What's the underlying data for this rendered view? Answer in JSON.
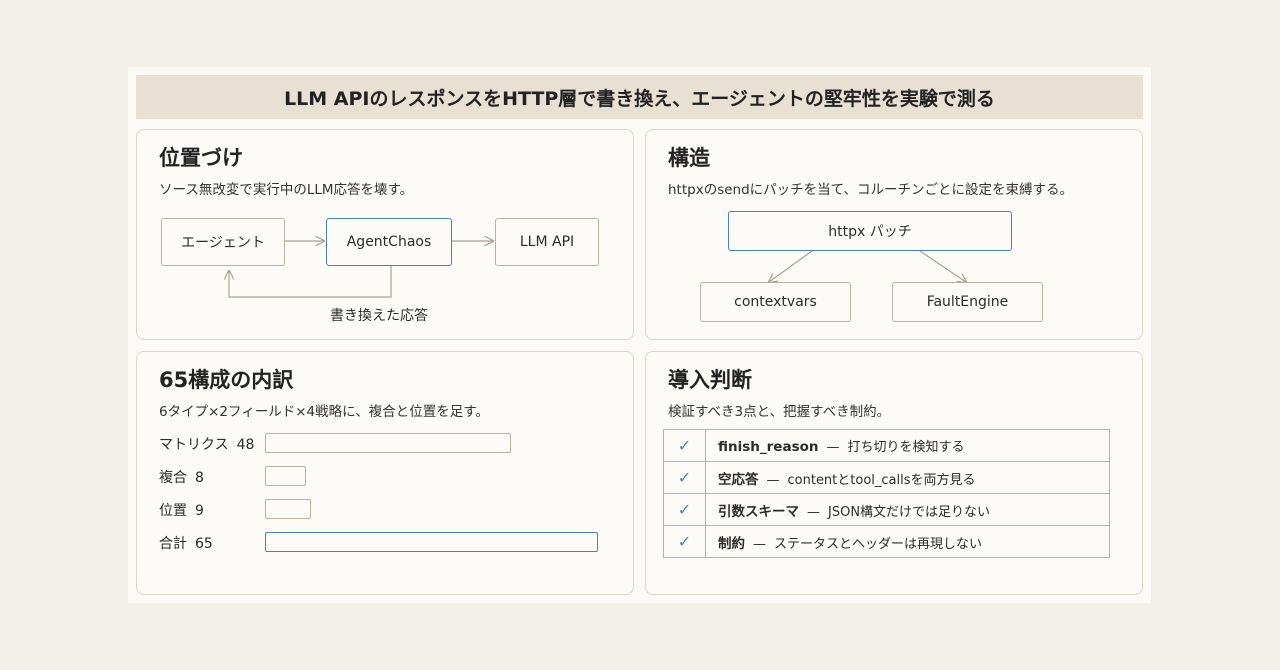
{
  "title": "LLM APIのレスポンスをHTTP層で書き換え、エージェントの堅牢性を実験で測る",
  "positioning": {
    "title": "位置づけ",
    "subtitle": "ソース無改変で実行中のLLM応答を壊す。",
    "nodes": {
      "agent": "エージェント",
      "agentchaos": "AgentChaos",
      "llm_api": "LLM API"
    },
    "edge_label": "書き換えた応答"
  },
  "structure": {
    "title": "構造",
    "subtitle": "httpxのsendにパッチを当て、コルーチンごとに設定を束縛する。",
    "nodes": {
      "patch": "httpx パッチ",
      "contextvars": "contextvars",
      "faultengine": "FaultEngine"
    }
  },
  "breakdown": {
    "title": "65構成の内訳",
    "subtitle": "6タイプ×2フィールド×4戦略に、複合と位置を足す。",
    "chart_data": {
      "type": "bar",
      "categories": [
        "マトリクス",
        "複合",
        "位置",
        "合計"
      ],
      "values": [
        48,
        8,
        9,
        65
      ],
      "highlight": "合計"
    }
  },
  "adoption": {
    "title": "導入判断",
    "subtitle": "検証すべき3点と、把握すべき制約。",
    "check_symbol": "✓",
    "dash": "—",
    "items": [
      {
        "key": "finish_reason",
        "desc": "打ち切りを検知する"
      },
      {
        "key": "空応答",
        "desc": "contentとtool_callsを両方見る"
      },
      {
        "key": "引数スキーマ",
        "desc": "JSON構文だけでは足りない"
      },
      {
        "key": "制約",
        "desc": "ステータスとヘッダーは再現しない"
      }
    ]
  },
  "colors": {
    "accent": "#4a7fc0",
    "border": "#b9b2a4",
    "title_bar": "#e8e1d3",
    "background": "#f2efe8"
  }
}
